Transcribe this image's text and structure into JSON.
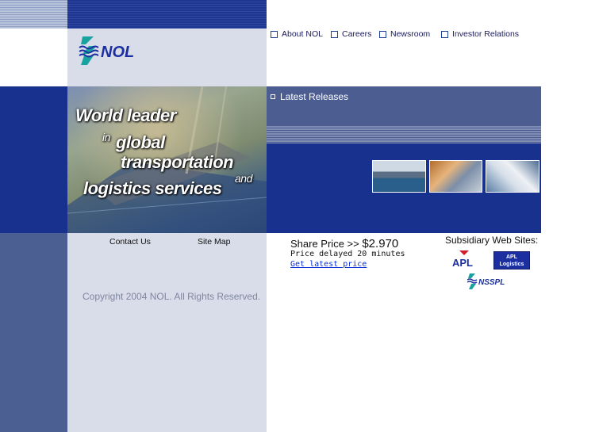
{
  "top_nav": [
    {
      "label": "About NOL"
    },
    {
      "label": "Careers"
    },
    {
      "label": "Newsroom"
    },
    {
      "label": "Investor Relations"
    }
  ],
  "logo_text": "NOL",
  "hero": {
    "line1": "World leader",
    "line2a": "in",
    "line2b": "global",
    "line3": "transportation",
    "line3b": "and",
    "line4": "logistics services"
  },
  "latest_releases": "Latest Releases",
  "footer_links": {
    "contact": "Contact Us",
    "sitemap": "Site Map"
  },
  "copyright": "Copyright 2004 NOL. All Rights Reserved.",
  "share": {
    "label": "Share Price >>",
    "price": "$2.970",
    "delay": "Price delayed 20 minutes",
    "link": "Get latest price"
  },
  "subsidiaries": {
    "title": "Subsidiary Web Sites:",
    "apl": "APL",
    "apl_logistics_1": "APL",
    "apl_logistics_2": "Logistics",
    "nsspl": "NSSPL"
  }
}
